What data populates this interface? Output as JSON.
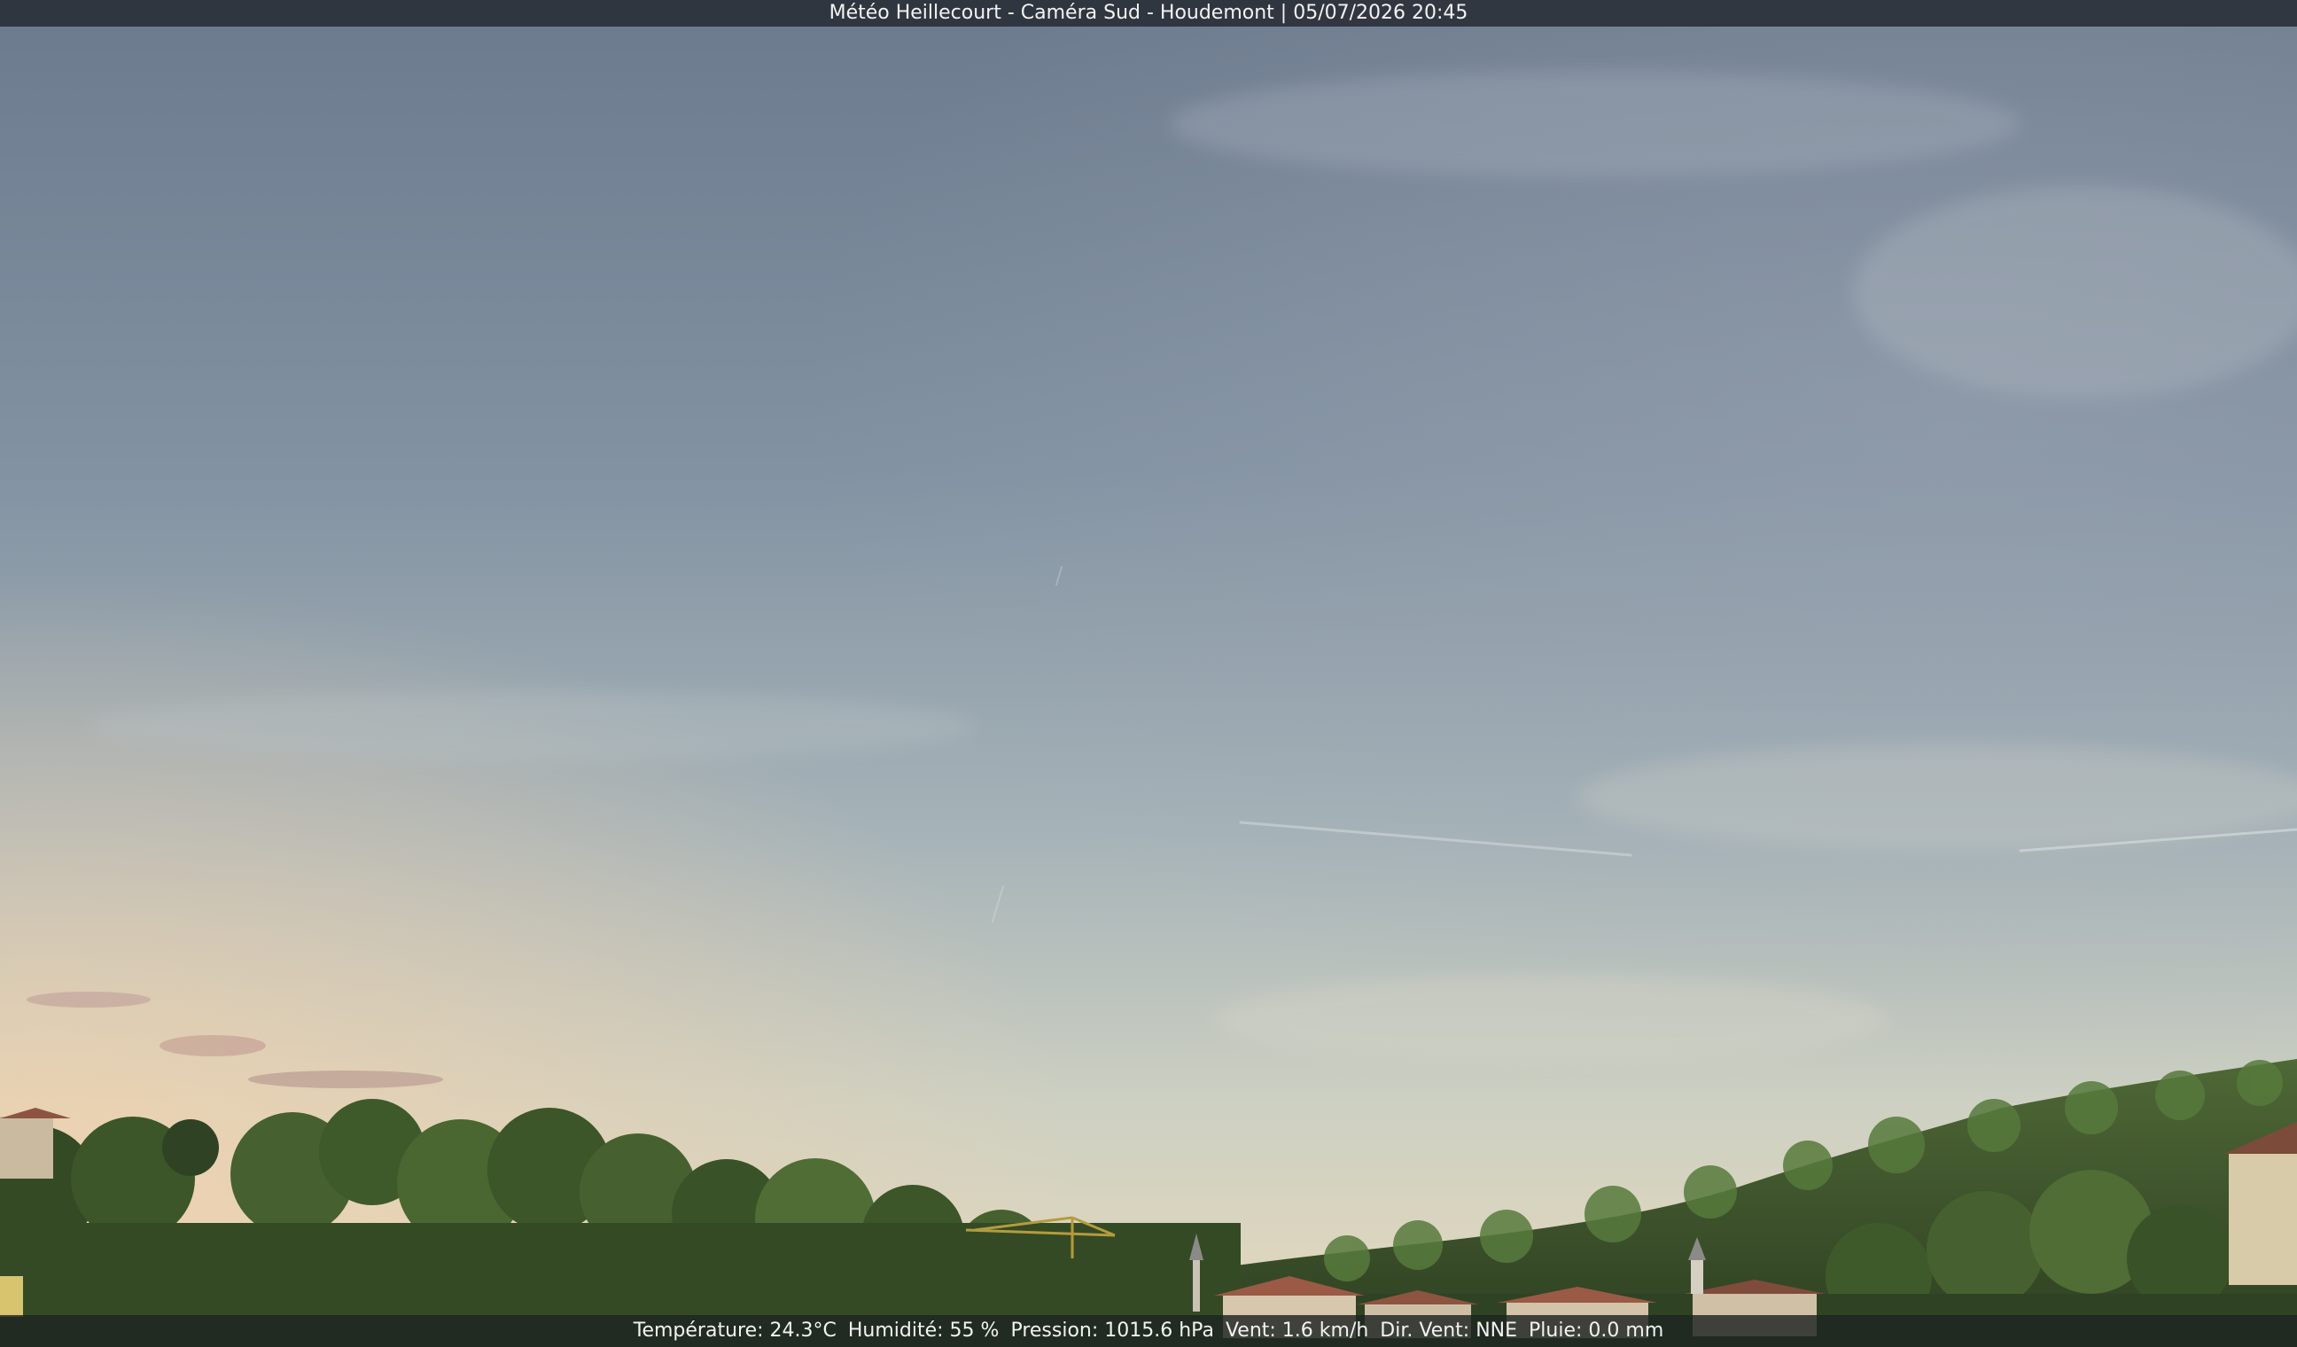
{
  "camera": {
    "title": "Météo Heillecourt - Caméra Sud - Houdemont | 05/07/2026 20:45"
  },
  "weather": {
    "temperature": "Température: 24.3°C",
    "humidity": "Humidité: 55 %",
    "pressure": "Pression: 1015.6 hPa",
    "wind_speed": "Vent: 1.6 km/h",
    "wind_direction": "Dir. Vent: NNE",
    "rain": "Pluie: 0.0 mm"
  },
  "colors": {
    "sky_top": "#6b7a8d",
    "sky_mid": "#9aa9b3",
    "sky_horizon": "#e3d7bd",
    "foliage_dark": "#2f4324",
    "foliage_light": "#5e7a3a",
    "roof": "#9a5a45"
  }
}
